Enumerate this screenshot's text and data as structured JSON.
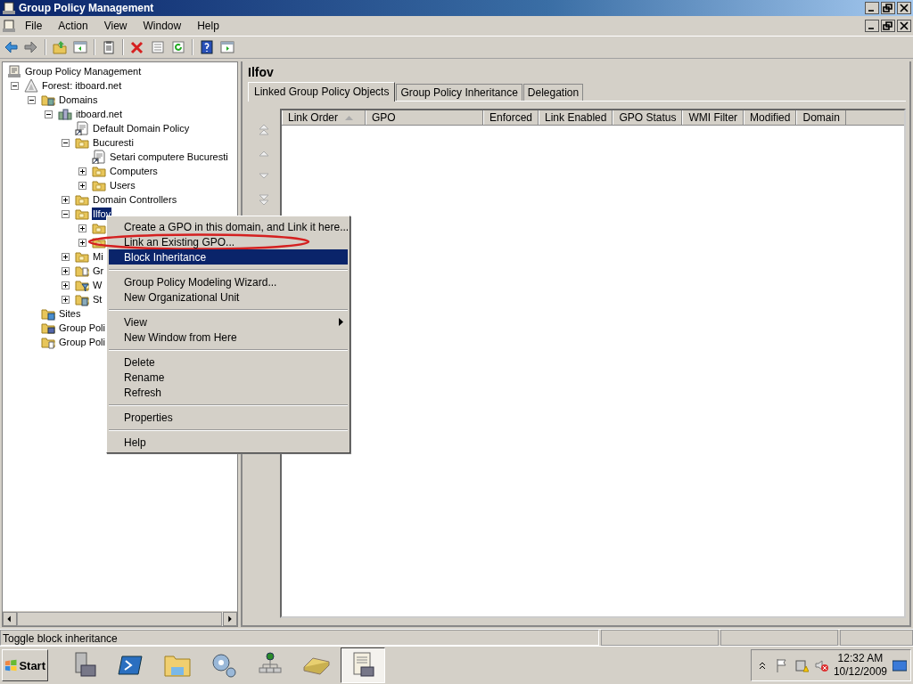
{
  "window": {
    "title": "Group Policy Management"
  },
  "menu_bar": [
    "File",
    "Action",
    "View",
    "Window",
    "Help"
  ],
  "toolbar": [
    {
      "kind": "back"
    },
    {
      "kind": "forward"
    },
    {
      "kind": "sep"
    },
    {
      "kind": "up"
    },
    {
      "kind": "tree"
    },
    {
      "kind": "sep"
    },
    {
      "kind": "export"
    },
    {
      "kind": "sep"
    },
    {
      "kind": "delete"
    },
    {
      "kind": "properties"
    },
    {
      "kind": "refresh"
    },
    {
      "kind": "sep"
    },
    {
      "kind": "help"
    },
    {
      "kind": "pane"
    }
  ],
  "tree": [
    {
      "label": "Group Policy Management",
      "kind": "console",
      "children": [
        {
          "label": "Forest: itboard.net",
          "kind": "forest",
          "expanded": true,
          "children": [
            {
              "label": "Domains",
              "kind": "domains",
              "expanded": true,
              "children": [
                {
                  "label": "itboard.net",
                  "kind": "domain",
                  "expanded": true,
                  "children": [
                    {
                      "label": "Default Domain Policy",
                      "kind": "gpo"
                    },
                    {
                      "label": "Bucuresti",
                      "kind": "ou",
                      "expanded": true,
                      "children": [
                        {
                          "label": "Setari computere Bucuresti",
                          "kind": "gpo"
                        },
                        {
                          "label": "Computers",
                          "kind": "ou",
                          "expanded": false
                        },
                        {
                          "label": "Users",
                          "kind": "ou",
                          "expanded": false
                        }
                      ]
                    },
                    {
                      "label": "Domain Controllers",
                      "kind": "ou",
                      "expanded": false
                    },
                    {
                      "label": "Ilfov",
                      "kind": "ou",
                      "expanded": true,
                      "selected": true,
                      "children": [
                        {
                          "kind": "ou",
                          "expanded": false
                        },
                        {
                          "kind": "ou",
                          "expanded": false
                        }
                      ]
                    },
                    {
                      "label": "Mi",
                      "kind": "ou",
                      "expanded": false
                    },
                    {
                      "label": "Gr",
                      "kind": "gpofolder",
                      "expanded": false
                    },
                    {
                      "label": "W",
                      "kind": "wmi",
                      "expanded": false
                    },
                    {
                      "label": "St",
                      "kind": "starter",
                      "expanded": false
                    }
                  ]
                }
              ]
            },
            {
              "label": "Sites",
              "kind": "sites"
            },
            {
              "label": "Group Poli",
              "kind": "modeling"
            },
            {
              "label": "Group Poli",
              "kind": "results"
            }
          ]
        }
      ]
    }
  ],
  "details": {
    "title": "Ilfov",
    "tabs": [
      {
        "label": "Linked Group Policy Objects",
        "selected": true
      },
      {
        "label": "Group Policy Inheritance",
        "selected": false
      },
      {
        "label": "Delegation",
        "selected": false
      }
    ],
    "order_buttons": [
      {
        "kind": "top"
      },
      {
        "kind": "up"
      },
      {
        "kind": "down"
      },
      {
        "kind": "bottom"
      }
    ],
    "columns": [
      {
        "label": "Link Order",
        "sorted": true
      },
      {
        "label": "GPO",
        "sorted": false
      },
      {
        "label": "Enforced",
        "sorted": false
      },
      {
        "label": "Link Enabled",
        "sorted": false
      },
      {
        "label": "GPO Status",
        "sorted": false
      },
      {
        "label": "WMI Filter",
        "sorted": false
      },
      {
        "label": "Modified",
        "sorted": false
      },
      {
        "label": "Domain",
        "sorted": false
      }
    ]
  },
  "context_menu": {
    "groups": [
      {
        "items": [
          {
            "label": "Create a GPO in this domain, and Link it here...",
            "selected": false,
            "circled": false,
            "submenu": false
          },
          {
            "label": "Link an Existing GPO...",
            "selected": false,
            "circled": true,
            "submenu": false
          },
          {
            "label": "Block Inheritance",
            "selected": true,
            "circled": false,
            "submenu": false
          }
        ]
      },
      {
        "items": [
          {
            "label": "Group Policy Modeling Wizard...",
            "selected": false,
            "circled": false,
            "submenu": false
          },
          {
            "label": "New Organizational Unit",
            "selected": false,
            "circled": false,
            "submenu": false
          }
        ]
      },
      {
        "items": [
          {
            "label": "View",
            "selected": false,
            "circled": false,
            "submenu": true
          },
          {
            "label": "New Window from Here",
            "selected": false,
            "circled": false,
            "submenu": false
          }
        ]
      },
      {
        "items": [
          {
            "label": "Delete",
            "selected": false,
            "circled": false,
            "submenu": false
          },
          {
            "label": "Rename",
            "selected": false,
            "circled": false,
            "submenu": false
          },
          {
            "label": "Refresh",
            "selected": false,
            "circled": false,
            "submenu": false
          }
        ]
      },
      {
        "items": [
          {
            "label": "Properties",
            "selected": false,
            "circled": false,
            "submenu": false
          }
        ]
      },
      {
        "items": [
          {
            "label": "Help",
            "selected": false,
            "circled": false,
            "submenu": false
          }
        ]
      }
    ]
  },
  "status_bar": {
    "text": "Toggle block inheritance"
  },
  "taskbar": {
    "start": "Start",
    "apps": [
      {
        "kind": "server",
        "active": false
      },
      {
        "kind": "shell",
        "active": false
      },
      {
        "kind": "explorer",
        "active": false
      },
      {
        "kind": "gears",
        "active": false
      },
      {
        "kind": "network",
        "active": false
      },
      {
        "kind": "book",
        "active": false
      },
      {
        "kind": "gpm",
        "active": true
      }
    ],
    "time": "12:32 AM",
    "date": "10/12/2009"
  }
}
